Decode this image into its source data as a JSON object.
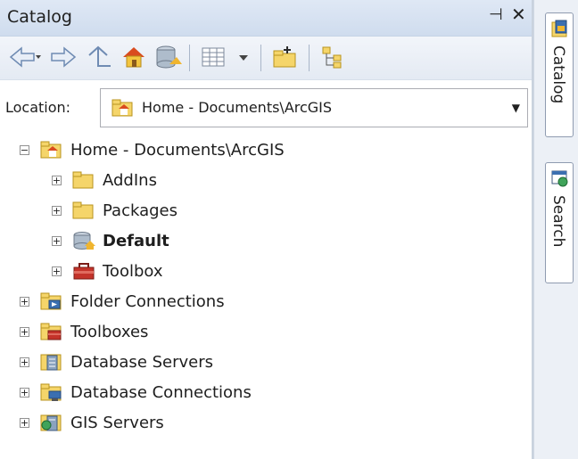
{
  "panel": {
    "title": "Catalog"
  },
  "location": {
    "label": "Location:",
    "value": "Home - Documents\\ArcGIS"
  },
  "tree": {
    "home": "Home - Documents\\ArcGIS",
    "addins": "AddIns",
    "packages": "Packages",
    "default": "Default",
    "toolbox": "Toolbox",
    "folder_connections": "Folder Connections",
    "toolboxes": "Toolboxes",
    "database_servers": "Database Servers",
    "database_connections": "Database Connections",
    "gis_servers": "GIS Servers"
  },
  "sidebar": {
    "catalog_tab": "Catalog",
    "search_tab": "Search"
  }
}
